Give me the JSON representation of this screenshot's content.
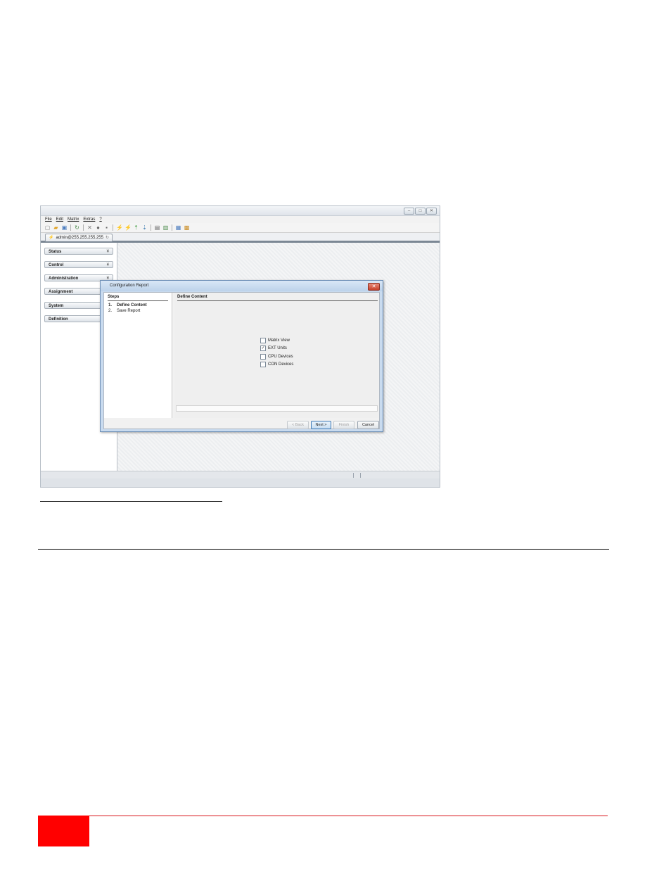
{
  "app": {
    "window_controls": [
      "–",
      "□",
      "✕"
    ],
    "menu": [
      "File",
      "Edit",
      "Matrix",
      "Extras",
      "?"
    ],
    "toolbar_icons": [
      "new-icon",
      "open-icon",
      "save-icon",
      "refresh-icon",
      "delete-icon",
      "copy-icon",
      "paste-icon",
      "connect-icon",
      "disconnect-icon",
      "upload-icon",
      "download-icon",
      "document-icon",
      "export-icon",
      "report-icon",
      "settings-icon"
    ],
    "tab_label": "admin@255.255.255.255",
    "sidebar": [
      {
        "label": "Status"
      },
      {
        "label": "Control"
      },
      {
        "label": "Administration"
      },
      {
        "label": "Assignment"
      },
      {
        "label": "System"
      },
      {
        "label": "Definition"
      }
    ]
  },
  "dialog": {
    "title": "Configuration Report",
    "steps_header": "Steps",
    "steps": [
      {
        "num": "1.",
        "label": "Define Content",
        "active": true
      },
      {
        "num": "2.",
        "label": "Save Report",
        "active": false
      }
    ],
    "content_header": "Define Content",
    "options": [
      {
        "label": "Matrix View",
        "checked": false
      },
      {
        "label": "EXT Units",
        "checked": true
      },
      {
        "label": "CPU Devices",
        "checked": false
      },
      {
        "label": "CON Devices",
        "checked": false
      }
    ],
    "buttons": {
      "back": "< Back",
      "next": "Next >",
      "finish": "Finish",
      "cancel": "Cancel"
    }
  },
  "colors": {
    "accent_red": "#ff0000",
    "footer_line": "#d8131a",
    "dialog_close": "#c7402b"
  }
}
